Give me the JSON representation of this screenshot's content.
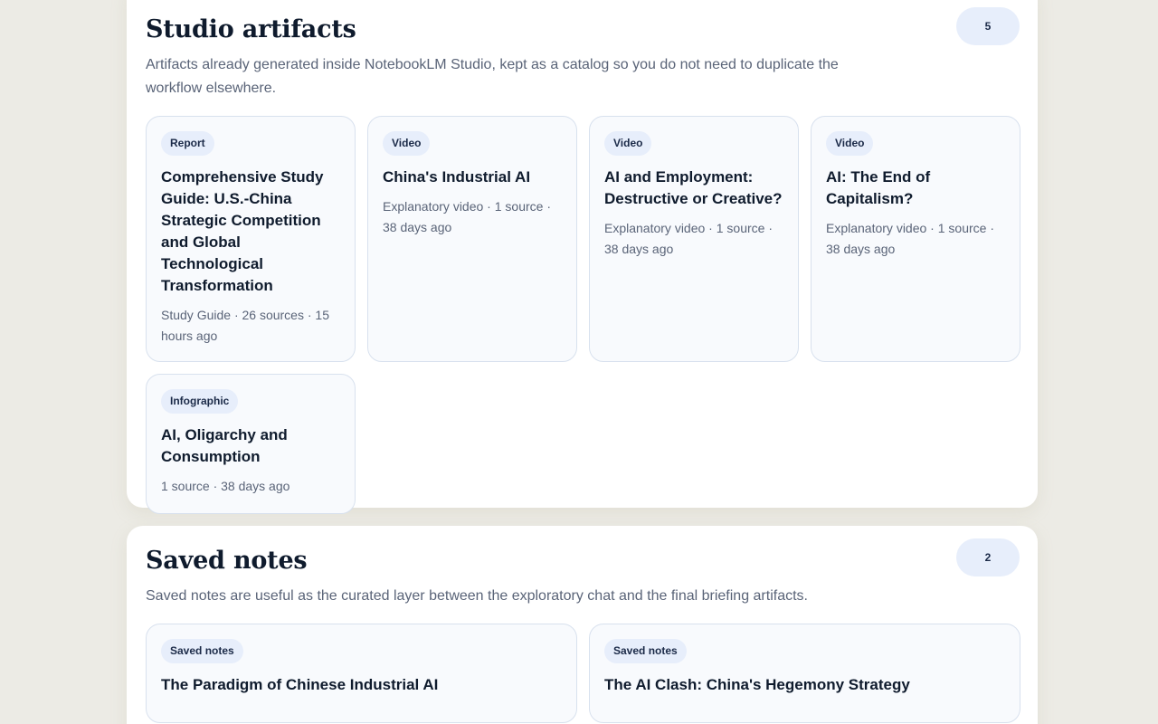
{
  "studio": {
    "title": "Studio artifacts",
    "count": "5",
    "description": "Artifacts already generated inside NotebookLM Studio, kept as a catalog so you do not need to duplicate the workflow elsewhere.",
    "cards": [
      {
        "tag": "Report",
        "title": "Comprehensive Study Guide: U.S.-China Strategic Competition and Global Technological Transformation",
        "meta": "Study Guide · 26 sources · 15 hours ago"
      },
      {
        "tag": "Video",
        "title": "China's Industrial AI",
        "meta": "Explanatory video · 1 source · 38 days ago"
      },
      {
        "tag": "Video",
        "title": "AI and Employment: Destructive or Creative?",
        "meta": "Explanatory video · 1 source · 38 days ago"
      },
      {
        "tag": "Video",
        "title": "AI: The End of Capitalism?",
        "meta": "Explanatory video · 1 source · 38 days ago"
      },
      {
        "tag": "Infographic",
        "title": "AI, Oligarchy and Consumption",
        "meta": "1 source · 38 days ago"
      }
    ]
  },
  "notes": {
    "title": "Saved notes",
    "count": "2",
    "description": "Saved notes are useful as the curated layer between the exploratory chat and the final briefing artifacts.",
    "cards": [
      {
        "tag": "Saved notes",
        "title": "The Paradigm of Chinese Industrial AI"
      },
      {
        "tag": "Saved notes",
        "title": "The AI Clash: China's Hegemony Strategy"
      }
    ]
  }
}
